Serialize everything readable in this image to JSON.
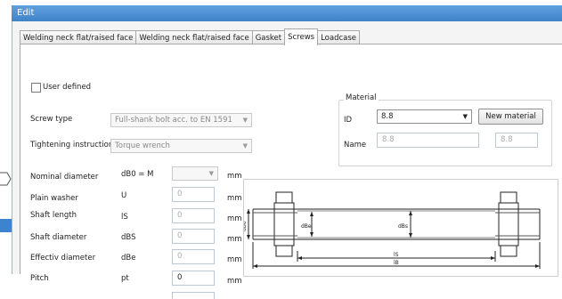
{
  "window": {
    "title": "Edit"
  },
  "tabs": [
    {
      "label": "Welding neck flat/raised face",
      "active": false
    },
    {
      "label": "Welding neck flat/raised face",
      "active": false
    },
    {
      "label": "Gasket",
      "active": false
    },
    {
      "label": "Screws",
      "active": true
    },
    {
      "label": "Loadcase",
      "active": false
    }
  ],
  "user_defined": {
    "label": "User defined",
    "checked": false
  },
  "screw_type": {
    "label": "Screw type",
    "value": "Full-shank bolt acc. to EN 1591"
  },
  "tightening": {
    "label": "Tightening instruction",
    "value": "Torque wrench"
  },
  "material": {
    "group_title": "Material",
    "id_label": "ID",
    "id_value": "8.8",
    "new_button": "New material",
    "name_label": "Name",
    "name_value": "8.8",
    "name_value2": "8.8"
  },
  "params": [
    {
      "label": "Nominal diameter",
      "symbol": "dB0 = M",
      "value": "",
      "unit": "mm",
      "kind": "combo"
    },
    {
      "label": "Plain washer",
      "symbol": "U",
      "value": "0",
      "unit": "mm",
      "kind": "input"
    },
    {
      "label": "Shaft length",
      "symbol": "lS",
      "value": "0",
      "unit": "mm",
      "kind": "input"
    },
    {
      "label": "Shaft diameter",
      "symbol": "dBS",
      "value": "0",
      "unit": "mm",
      "kind": "input"
    },
    {
      "label": "Effectiv diameter",
      "symbol": "dBe",
      "value": "0",
      "unit": "mm",
      "kind": "input"
    },
    {
      "label": "Pitch",
      "symbol": "pt",
      "value": "0",
      "unit": "mm",
      "kind": "input-dark"
    }
  ],
  "diagram": {
    "label_dB0": "dB0",
    "label_dBe": "dBe",
    "label_dBs": "dBs",
    "label_lS": "lS",
    "label_lB": "lB"
  },
  "colors": {
    "titlebar": "#4a8fd4",
    "selection": "#3d84cf"
  }
}
